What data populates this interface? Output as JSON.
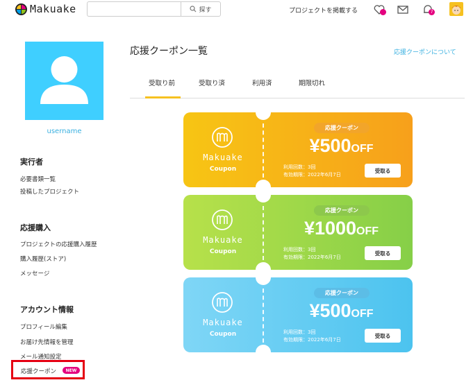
{
  "header": {
    "logo_text": "Makuake",
    "search": {
      "placeholder": "",
      "button_label": "探す"
    },
    "post_project_label": "プロジェクトを掲載する",
    "notification_count": "7",
    "colors": {
      "brand_yellow": "#f6c120",
      "brand_pink": "#e4007f",
      "brand_blue": "#00a0e9",
      "brand_green": "#8fc31f"
    }
  },
  "sidebar": {
    "username": "username",
    "sections": [
      {
        "heading": "実行者",
        "links": [
          "必要書類一覧",
          "投稿したプロジェクト"
        ]
      },
      {
        "heading": "応援購入",
        "links": [
          "プロジェクトの応援購入履歴",
          "購入履歴(ストア)",
          "メッセージ"
        ]
      },
      {
        "heading": "アカウント情報",
        "links": [
          "プロフィール編集",
          "お届け先情報を管理",
          "メール通知設定"
        ]
      }
    ],
    "coupon_link": {
      "label": "応援クーポン",
      "badge": "NEW"
    }
  },
  "main": {
    "title": "応援クーポン一覧",
    "help_link": "応援クーポンについて",
    "tabs": [
      {
        "label": "受取り前",
        "active": true
      },
      {
        "label": "受取り済",
        "active": false
      },
      {
        "label": "利用済",
        "active": false
      },
      {
        "label": "期限切れ",
        "active": false
      }
    ],
    "coupons": [
      {
        "brand": "Makuake",
        "brand_sub": "Coupon",
        "tag": "応援クーポン",
        "amount": "¥500",
        "amount_suffix": "OFF",
        "uses": "利用回数：3回",
        "expiry": "有効期限：2022年6月7日",
        "button": "受取る",
        "gradient": [
          "#f7c514",
          "#f7a01b"
        ],
        "tag_color": "#f2a52a"
      },
      {
        "brand": "Makuake",
        "brand_sub": "Coupon",
        "tag": "応援クーポン",
        "amount": "¥1000",
        "amount_suffix": "OFF",
        "uses": "利用回数：3回",
        "expiry": "有効期限：2022年6月7日",
        "button": "受取る",
        "gradient": [
          "#b7e14a",
          "#86cf48"
        ],
        "tag_color": "#8dc84c"
      },
      {
        "brand": "Makuake",
        "brand_sub": "Coupon",
        "tag": "応援クーポン",
        "amount": "¥500",
        "amount_suffix": "OFF",
        "uses": "利用回数：3回",
        "expiry": "有効期限：2022年6月7日",
        "button": "受取る",
        "gradient": [
          "#7fd6f6",
          "#4cc3ef"
        ],
        "tag_color": "#5cbde6"
      }
    ]
  }
}
